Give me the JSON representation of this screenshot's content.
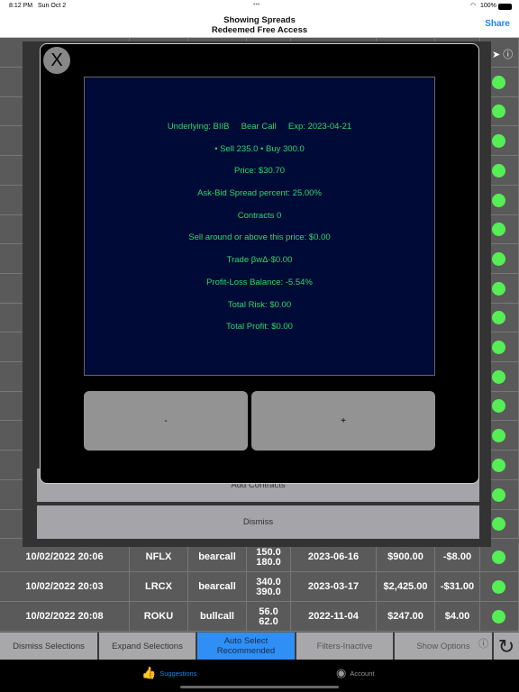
{
  "status_bar": {
    "time": "8:12 PM",
    "date": "Sun Oct 2",
    "dots": "•••",
    "battery": "100%"
  },
  "nav": {
    "title": "Showing Spreads",
    "subtitle": "Redeemed Free Access",
    "share": "Share"
  },
  "table": {
    "rows": [
      {
        "date": "10/02/2022 20:06",
        "symbol": "NFLX",
        "type": "bearcall",
        "strikes": [
          "150.0",
          "180.0"
        ],
        "exp": "2023-06-16",
        "risk": "$900.00",
        "profit": "-$8.00"
      },
      {
        "date": "10/02/2022 20:03",
        "symbol": "LRCX",
        "type": "bearcall",
        "strikes": [
          "340.0",
          "390.0"
        ],
        "exp": "2023-03-17",
        "risk": "$2,425.00",
        "profit": "-$31.00"
      },
      {
        "date": "10/02/2022 20:08",
        "symbol": "ROKU",
        "type": "bullcall",
        "strikes": [
          "56.0",
          "62.0"
        ],
        "exp": "2022-11-04",
        "risk": "$247.00",
        "profit": "$4.00"
      }
    ],
    "status_color": "#55ee55"
  },
  "modal": {
    "close": "X",
    "lines": [
      "Underlying: BIIB     Bear Call     Exp: 2023-04-21",
      "• Sell 235.0 • Buy 300.0",
      "Price: $30.70",
      "Ask-Bid Spread percent: 25.00%",
      "Contracts 0",
      "Sell around or above this price: $0.00",
      "Trade βwΔ-$0.00",
      "Profit-Loss Balance: -5.54%",
      "Total Risk: $0.00",
      "Total Profit: $0.00"
    ],
    "minus": "-",
    "plus": "+"
  },
  "sheet": {
    "add_contracts": "Add Contracts",
    "dismiss": "Dismiss"
  },
  "toolbar": {
    "dismiss_selections": "Dismiss Selections",
    "expand_selections": "Expand Selections",
    "auto_select": "Auto Select Recommended",
    "filters": "Filters-Inactive",
    "show_options": "Show Options",
    "accent": "#2f8ff5"
  },
  "tabs": {
    "suggestions": "Suggestions",
    "account": "Account"
  }
}
